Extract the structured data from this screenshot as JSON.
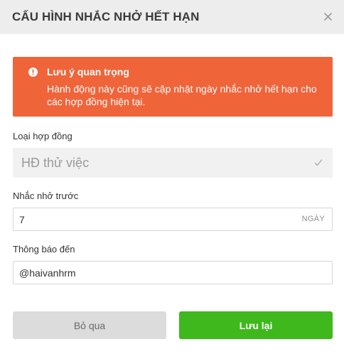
{
  "header": {
    "title": "CẤU HÌNH NHẮC NHỞ HẾT HẠN",
    "close_icon": "close-icon"
  },
  "alert": {
    "icon": "exclamation-circle-icon",
    "title": "Lưu ý quan trọng",
    "message": "Hành động này cũng sẽ cập nhật ngày nhắc nhở hết hạn cho các hợp đồng hiện tại.",
    "color": "#f0643a"
  },
  "form": {
    "contract_type": {
      "label": "Loại hợp đồng",
      "value": "HĐ thử việc",
      "icon": "check-icon"
    },
    "remind_before": {
      "label": "Nhắc nhở trước",
      "value": "7",
      "unit": "NGÀY"
    },
    "notify_to": {
      "label": "Thông báo đến",
      "value": "@haivanhrm"
    }
  },
  "footer": {
    "cancel_label": "Bỏ qua",
    "save_label": "Lưu lại",
    "save_color": "#3eb81c"
  }
}
